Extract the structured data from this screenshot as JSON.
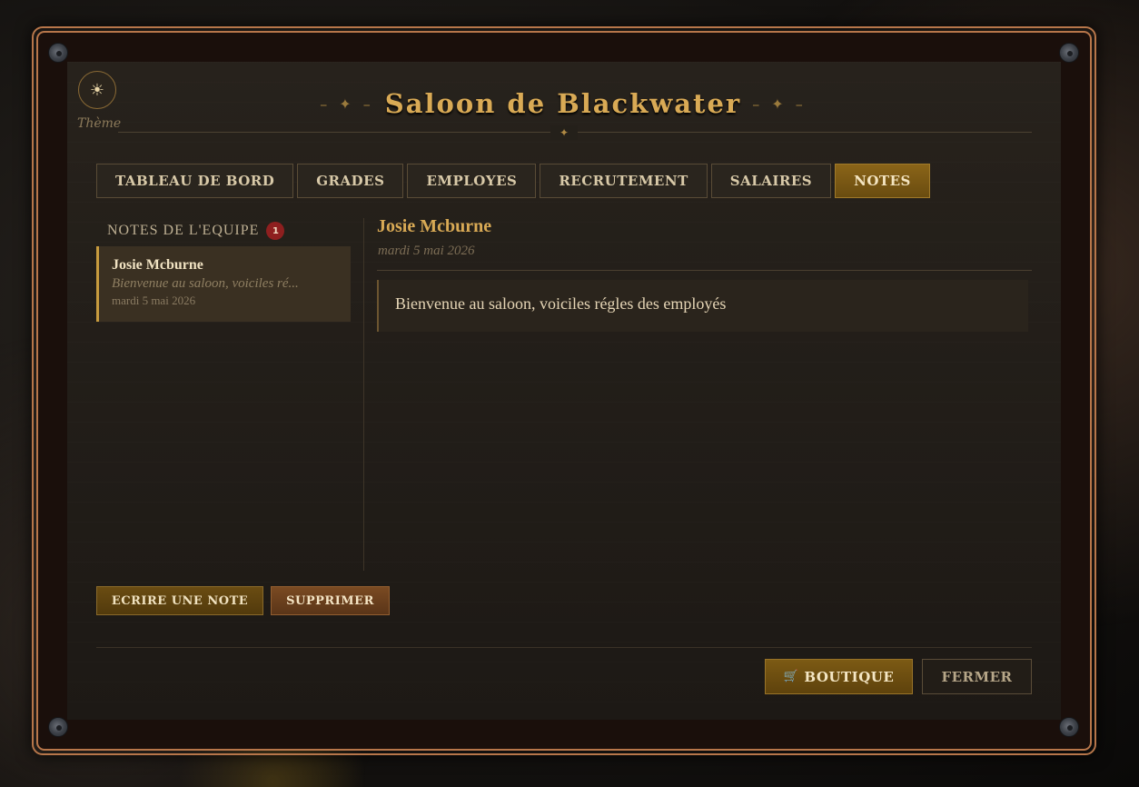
{
  "theme": {
    "icon": "sun-icon",
    "label": "Thème"
  },
  "header": {
    "title": "Saloon de Blackwater",
    "ornament_left": "– ✦ –",
    "ornament_right": "– ✦ –",
    "divider_star": "✦"
  },
  "tabs": [
    {
      "label": "TABLEAU DE BORD",
      "active": false
    },
    {
      "label": "GRADES",
      "active": false
    },
    {
      "label": "EMPLOYES",
      "active": false
    },
    {
      "label": "RECRUTEMENT",
      "active": false
    },
    {
      "label": "SALAIRES",
      "active": false
    },
    {
      "label": "NOTES",
      "active": true
    }
  ],
  "notes_list": {
    "header": "NOTES DE L'EQUIPE",
    "count": "1",
    "items": [
      {
        "author": "Josie Mcburne",
        "preview": "Bienvenue au saloon, voiciles ré...",
        "date": "mardi 5 mai 2026"
      }
    ]
  },
  "note_detail": {
    "author": "Josie Mcburne",
    "date": "mardi 5 mai 2026",
    "body": "Bienvenue au saloon, voiciles régles des employés"
  },
  "actions": {
    "write": "ECRIRE UNE NOTE",
    "delete": "SUPPRIMER"
  },
  "footer": {
    "shop_icon": "🛒",
    "shop": "BOUTIQUE",
    "close": "FERMER"
  },
  "colors": {
    "accent_gold": "#d9aa55",
    "frame_copper": "#b7764a",
    "badge_red": "#8e1f1f",
    "active_tab": "#8a6418"
  }
}
